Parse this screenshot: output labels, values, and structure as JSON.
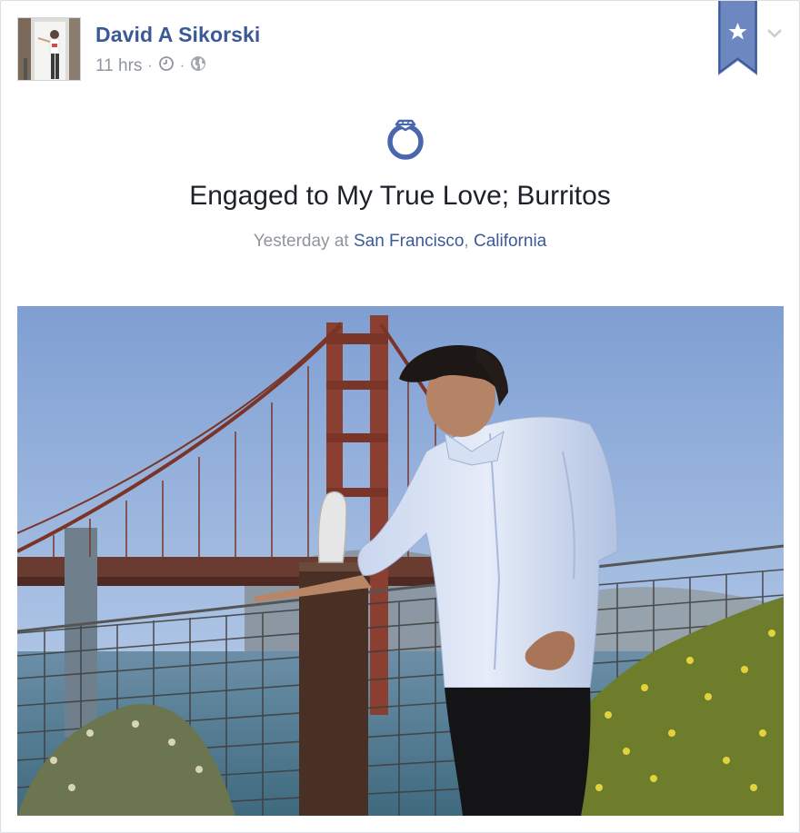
{
  "post": {
    "author": "David A Sikorski",
    "time": "11 hrs",
    "separator": "·"
  },
  "life_event": {
    "title": "Engaged to My True Love; Burritos",
    "date_prefix": "Yesterday at",
    "city": "San Francisco",
    "comma": ",",
    "state": "California"
  },
  "icons": {
    "clock": "clock-icon",
    "audience": "globe-icon",
    "bookmark": "star-icon",
    "menu": "chevron-down-icon",
    "event": "ring-icon"
  },
  "colors": {
    "link": "#3b5998",
    "muted": "#90949c",
    "bookmark": "#6d87c0"
  }
}
